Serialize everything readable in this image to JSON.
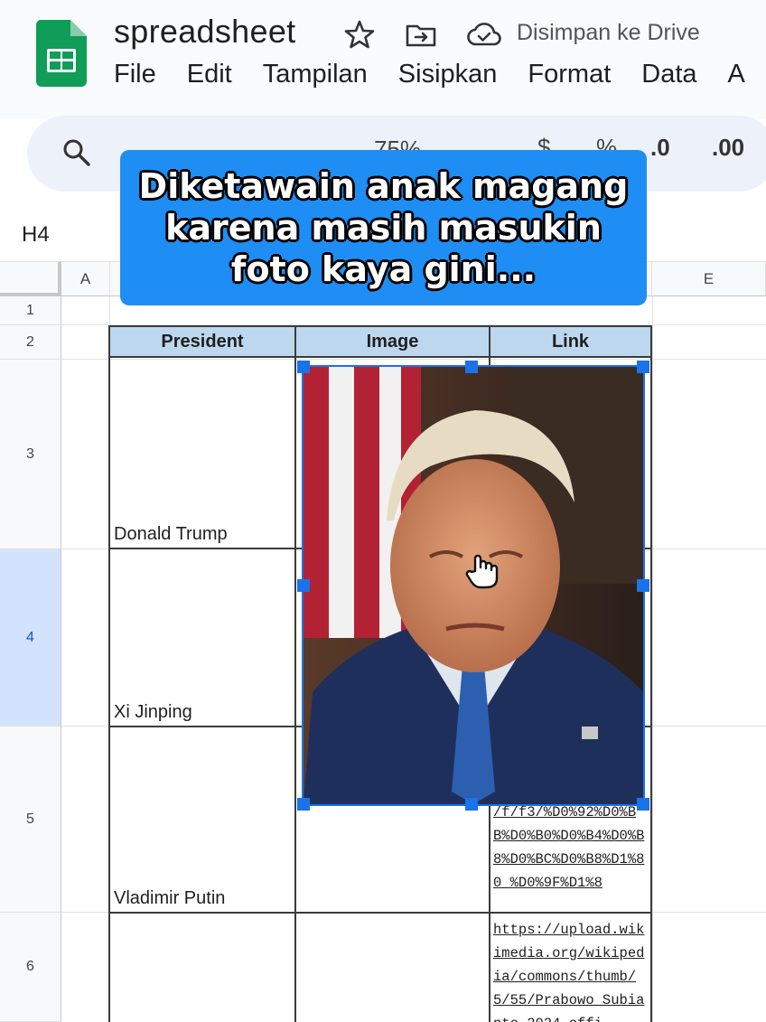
{
  "app": {
    "doc_title": "spreadsheet",
    "save_status": "Disimpan ke Drive",
    "menu": [
      "File",
      "Edit",
      "Tampilan",
      "Sisipkan",
      "Format",
      "Data",
      "A"
    ]
  },
  "toolbar": {
    "zoom": "75%",
    "currency": "$",
    "percent": "%",
    "decrease_decimal": ".0",
    "increase_decimal": ".00"
  },
  "name_box": "H4",
  "columns": [
    "A",
    "E"
  ],
  "rows": [
    "1",
    "2",
    "3",
    "4",
    "5",
    "6"
  ],
  "table": {
    "headers": [
      "President",
      "Image",
      "Link"
    ],
    "presidents": [
      "Donald Trump",
      "Xi Jinping",
      "Vladimir Putin"
    ],
    "links": {
      "row5": "/f/f3/%D0%92%D0%BB%D0%B0%D0%B4%D0%B8%D0%BC%D0%B8%D1%80_%D0%9F%D1%8",
      "row6": "https://upload.wikimedia.org/wikipedia/commons/thumb/5/55/Prabowo_Subianto_2024_offi"
    }
  },
  "overlay_caption": "Diketawain anak magang karena masih masukin foto kaya gini...",
  "colors": {
    "accent": "#1a73e8",
    "caption_bg": "#1e8ef5",
    "header_fill": "#bdd7ee",
    "sheets_green": "#0f9d58"
  },
  "icons": [
    "sheets-logo-icon",
    "star-icon",
    "move-folder-icon",
    "cloud-saved-icon",
    "search-icon",
    "hand-cursor-icon"
  ]
}
